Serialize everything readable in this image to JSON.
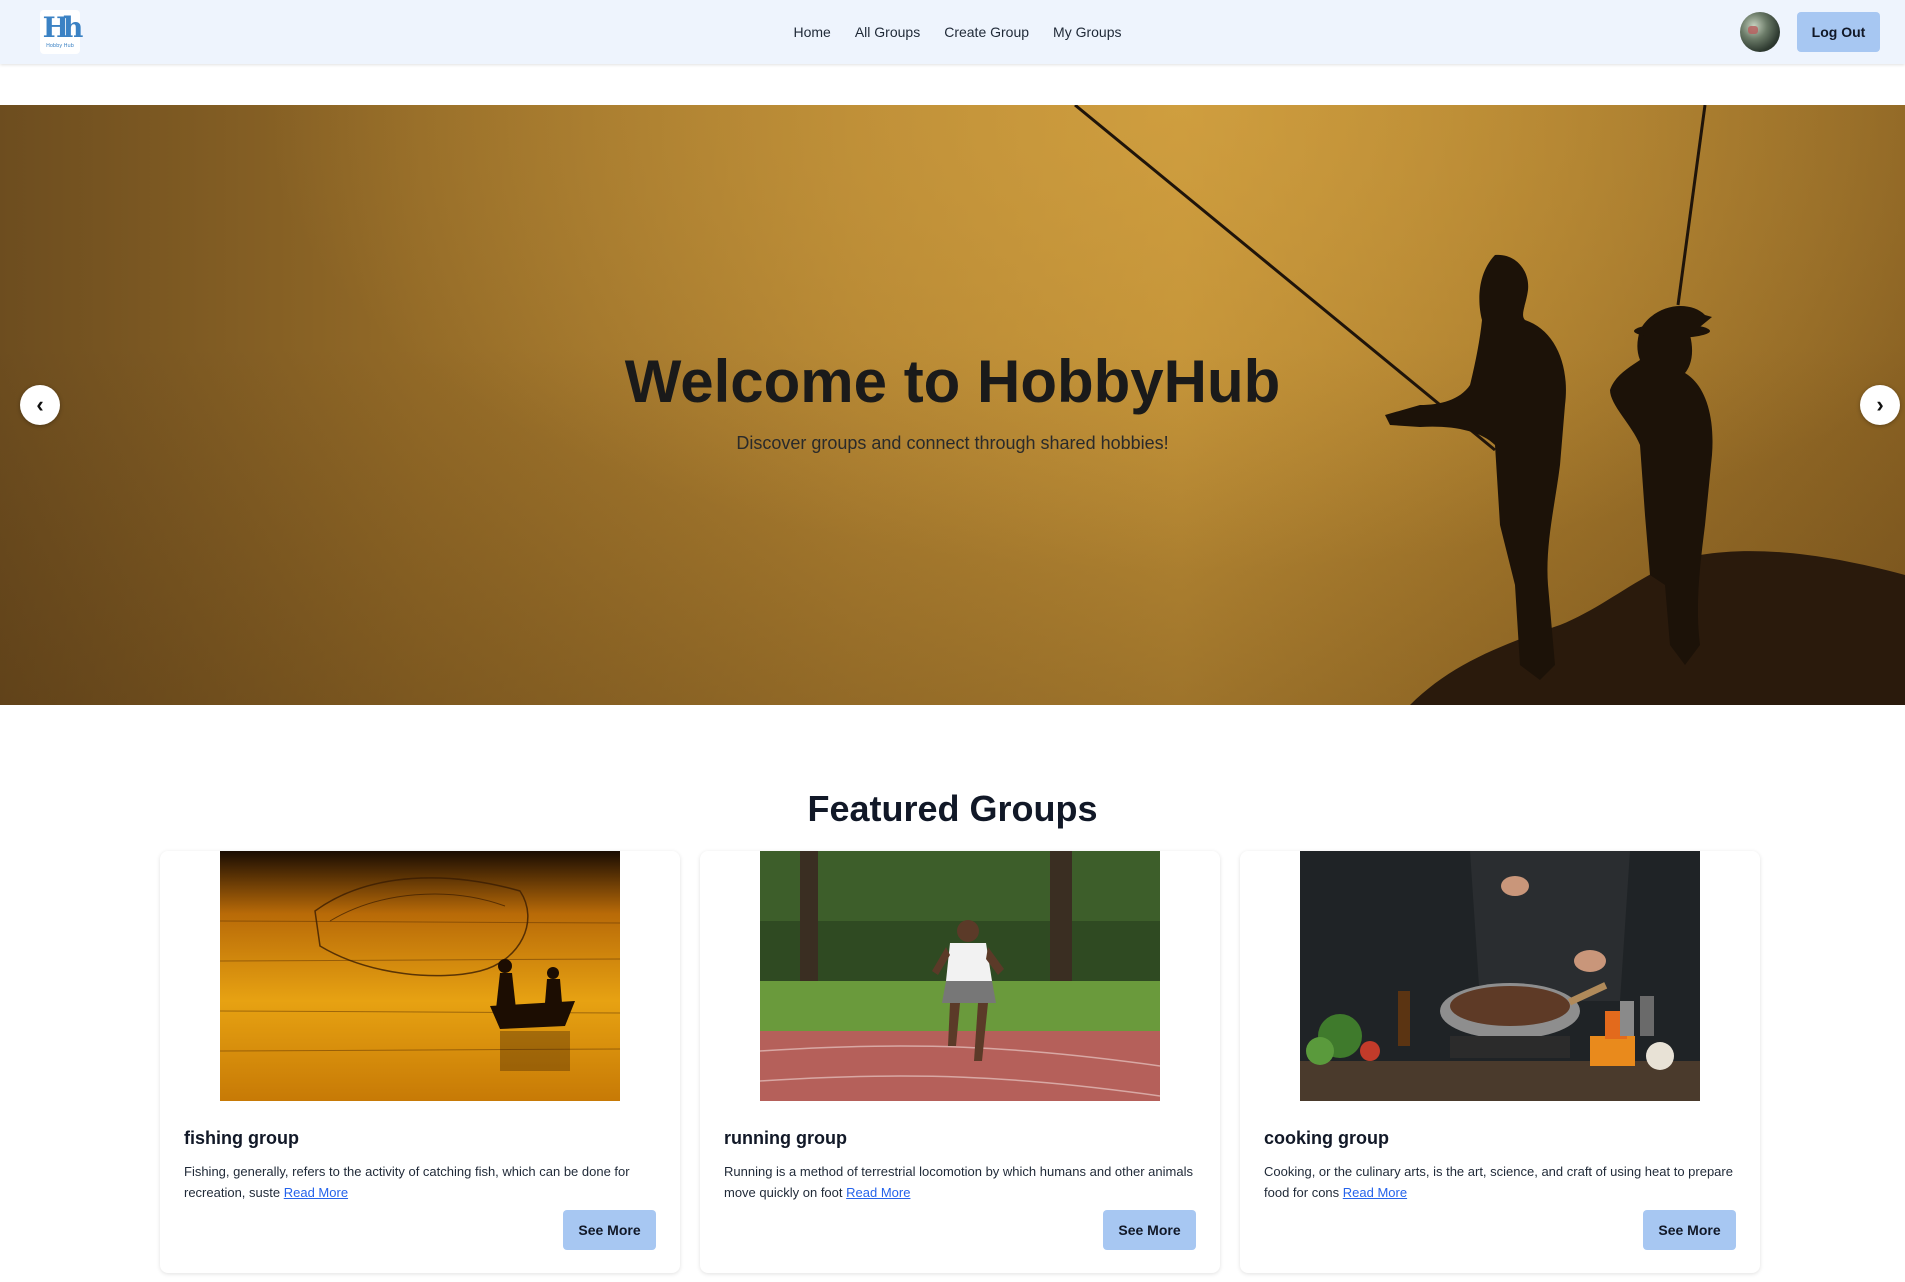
{
  "nav": {
    "logo_mark": "Hh",
    "logo_text": "Hobby Hub",
    "links": [
      "Home",
      "All Groups",
      "Create Group",
      "My Groups"
    ],
    "logout_label": "Log Out"
  },
  "hero": {
    "title": "Welcome to HobbyHub",
    "subtitle": "Discover groups and connect through shared hobbies!",
    "prev_label": "‹",
    "next_label": "›"
  },
  "featured": {
    "title": "Featured Groups",
    "cards": [
      {
        "title": "fishing group",
        "desc": "Fishing, generally, refers to the activity of catching fish, which can be done for recreation, suste",
        "read_more": "Read More",
        "button": "See More"
      },
      {
        "title": "running group",
        "desc": "Running is a method of terrestrial locomotion by which humans and other animals move quickly on foot",
        "read_more": "Read More",
        "button": "See More"
      },
      {
        "title": "cooking group",
        "desc": "Cooking, or the culinary arts, is the art, science, and craft of using heat to prepare food for cons",
        "read_more": "Read More",
        "button": "See More"
      }
    ]
  },
  "colors": {
    "nav_bg": "#eef4fd",
    "button_bg": "#a7c7f2",
    "link": "#2563eb",
    "hero_gold": "#b08231"
  }
}
